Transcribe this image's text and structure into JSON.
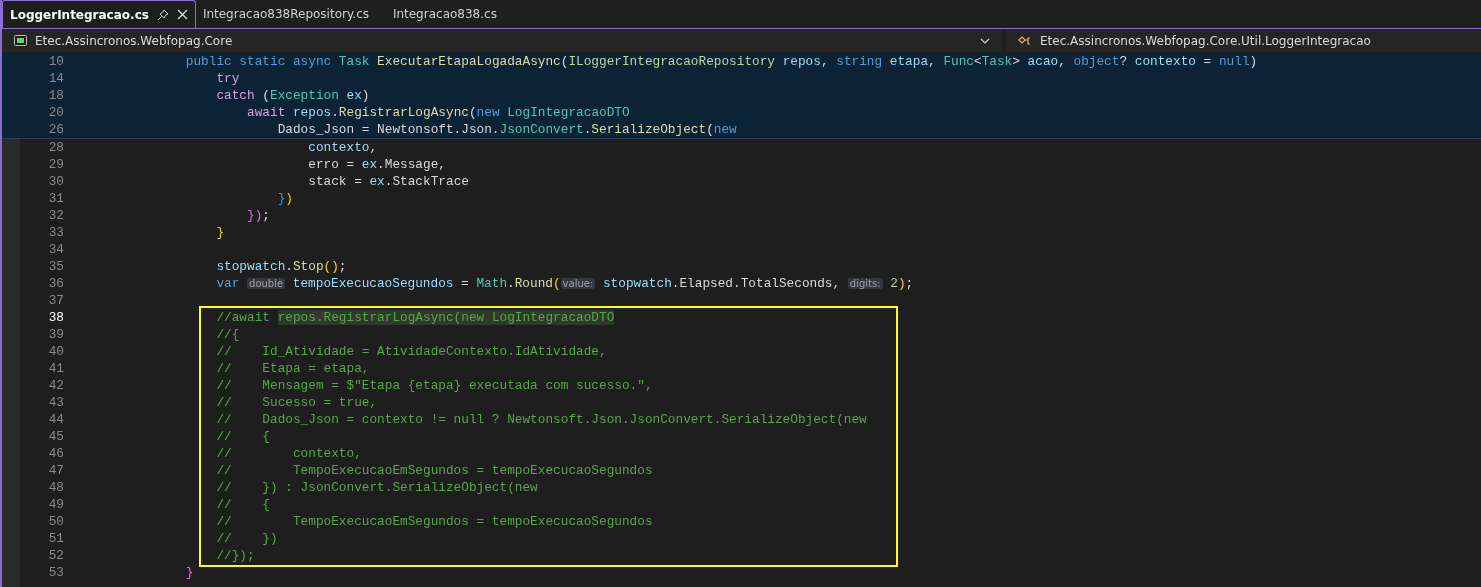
{
  "tabs": [
    {
      "label": "LoggerIntegracao.cs",
      "selected": true
    },
    {
      "label": "Integracao838Repository.cs",
      "selected": false
    },
    {
      "label": "Integracao838.cs",
      "selected": false
    }
  ],
  "navigation": {
    "project": "Etec.Assincronos.Webfopag.Core",
    "member": "Etec.Assincronos.Webfopag.Core.Util.LoggerIntegracao"
  },
  "sticky_lines": [
    {
      "number": "10",
      "tokens": [
        {
          "text": "            public static async ",
          "kind": "kw"
        },
        {
          "text": "Task ",
          "kind": "type"
        },
        {
          "text": "ExecutarEtapaLogadaAsync",
          "kind": "method"
        },
        {
          "text": "(",
          "kind": "plain"
        },
        {
          "text": "ILoggerIntegracaoRepository",
          "kind": "iface"
        },
        {
          "text": " repos",
          "kind": "var"
        },
        {
          "text": ", ",
          "kind": "plain"
        },
        {
          "text": "string",
          "kind": "kw"
        },
        {
          "text": " etapa",
          "kind": "var"
        },
        {
          "text": ", ",
          "kind": "plain"
        },
        {
          "text": "Func",
          "kind": "type"
        },
        {
          "text": "<",
          "kind": "plain"
        },
        {
          "text": "Task",
          "kind": "type"
        },
        {
          "text": "> ",
          "kind": "plain"
        },
        {
          "text": "acao",
          "kind": "var"
        },
        {
          "text": ", ",
          "kind": "plain"
        },
        {
          "text": "object",
          "kind": "kw"
        },
        {
          "text": "? ",
          "kind": "plain"
        },
        {
          "text": "contexto",
          "kind": "var"
        },
        {
          "text": " = ",
          "kind": "plain"
        },
        {
          "text": "null",
          "kind": "kw"
        },
        {
          "text": ")",
          "kind": "plain"
        }
      ]
    },
    {
      "number": "14",
      "tokens": [
        {
          "text": "                try",
          "kind": "ctrl"
        }
      ]
    },
    {
      "number": "18",
      "tokens": [
        {
          "text": "                catch",
          "kind": "ctrl"
        },
        {
          "text": " (",
          "kind": "plain"
        },
        {
          "text": "Exception",
          "kind": "type"
        },
        {
          "text": " ex",
          "kind": "var"
        },
        {
          "text": ")",
          "kind": "plain"
        }
      ]
    },
    {
      "number": "20",
      "tokens": [
        {
          "text": "                    await",
          "kind": "ctrl"
        },
        {
          "text": " repos",
          "kind": "var"
        },
        {
          "text": ".",
          "kind": "plain"
        },
        {
          "text": "RegistrarLogAsync",
          "kind": "method"
        },
        {
          "text": "(",
          "kind": "plain"
        },
        {
          "text": "new",
          "kind": "kw"
        },
        {
          "text": " LogIntegracaoDTO",
          "kind": "type"
        }
      ]
    },
    {
      "number": "26",
      "tokens": [
        {
          "text": "                        Dados_Json = Newtonsoft.Json.",
          "kind": "plain"
        },
        {
          "text": "JsonConvert",
          "kind": "type"
        },
        {
          "text": ".",
          "kind": "plain"
        },
        {
          "text": "SerializeObject",
          "kind": "method"
        },
        {
          "text": "(",
          "kind": "plain"
        },
        {
          "text": "new",
          "kind": "kw"
        }
      ]
    }
  ],
  "lines": [
    {
      "number": "28",
      "current": false,
      "tokens": [
        {
          "text": "                            contexto",
          "kind": "var"
        },
        {
          "text": ",",
          "kind": "plain"
        }
      ]
    },
    {
      "number": "29",
      "current": false,
      "tokens": [
        {
          "text": "                            erro = ",
          "kind": "plain"
        },
        {
          "text": "ex",
          "kind": "var"
        },
        {
          "text": ".Message,",
          "kind": "plain"
        }
      ]
    },
    {
      "number": "30",
      "current": false,
      "tokens": [
        {
          "text": "                            stack = ",
          "kind": "plain"
        },
        {
          "text": "ex",
          "kind": "var"
        },
        {
          "text": ".StackTrace",
          "kind": "plain"
        }
      ]
    },
    {
      "number": "31",
      "current": false,
      "tokens": [
        {
          "text": "                        }",
          "kind": "brace3"
        },
        {
          "text": ")",
          "kind": "brace1"
        }
      ]
    },
    {
      "number": "32",
      "current": false,
      "tokens": [
        {
          "text": "                    })",
          "kind": "brace2"
        },
        {
          "text": ";",
          "kind": "plain"
        }
      ]
    },
    {
      "number": "33",
      "current": false,
      "tokens": [
        {
          "text": "                }",
          "kind": "brace1"
        }
      ]
    },
    {
      "number": "34",
      "current": false
    },
    {
      "number": "35",
      "current": false,
      "tokens": [
        {
          "text": "                stopwatch",
          "kind": "var"
        },
        {
          "text": ".",
          "kind": "plain"
        },
        {
          "text": "Stop",
          "kind": "method"
        },
        {
          "text": "()",
          "kind": "brace1"
        },
        {
          "text": ";",
          "kind": "plain"
        }
      ]
    },
    {
      "number": "36",
      "current": false,
      "tokens": [
        {
          "text": "                var ",
          "kind": "kw"
        },
        {
          "text": "double",
          "kind": "hint"
        },
        {
          "text": " tempoExecucaoSegundos",
          "kind": "var"
        },
        {
          "text": " = ",
          "kind": "plain"
        },
        {
          "text": "Math",
          "kind": "type"
        },
        {
          "text": ".",
          "kind": "plain"
        },
        {
          "text": "Round",
          "kind": "method"
        },
        {
          "text": "(",
          "kind": "brace1"
        },
        {
          "text": "value:",
          "kind": "hint"
        },
        {
          "text": " stopwatch",
          "kind": "var"
        },
        {
          "text": ".Elapsed.TotalSeconds, ",
          "kind": "plain"
        },
        {
          "text": "digits:",
          "kind": "hint"
        },
        {
          "text": " 2",
          "kind": "num"
        },
        {
          "text": ")",
          "kind": "brace1"
        },
        {
          "text": ";",
          "kind": "plain"
        }
      ]
    },
    {
      "number": "37",
      "current": false
    },
    {
      "kind": "highlight_box",
      "lines": [
        {
          "number": "38",
          "current": true,
          "tokens": [
            {
              "text": "                //await ",
              "kind": "comment"
            },
            {
              "text": "repos.RegistrarLogAsync(new LogIntegracaoDTO",
              "kind": "marked"
            }
          ]
        },
        {
          "number": "39",
          "current": false,
          "tokens": [
            {
              "text": "                //{",
              "kind": "comment"
            }
          ]
        },
        {
          "number": "40",
          "current": false,
          "tokens": [
            {
              "text": "                //    Id_Atividade = AtividadeContexto.IdAtividade,",
              "kind": "comment"
            }
          ]
        },
        {
          "number": "41",
          "current": false,
          "tokens": [
            {
              "text": "                //    Etapa = etapa,",
              "kind": "comment"
            }
          ]
        },
        {
          "number": "42",
          "current": false,
          "tokens": [
            {
              "text": "                //    Mensagem = $\"Etapa {etapa} executada com sucesso.\",",
              "kind": "comment"
            }
          ]
        },
        {
          "number": "43",
          "current": false,
          "tokens": [
            {
              "text": "                //    Sucesso = true,",
              "kind": "comment"
            }
          ]
        },
        {
          "number": "44",
          "current": false,
          "tokens": [
            {
              "text": "                //    Dados_Json = contexto != null ? Newtonsoft.Json.JsonConvert.SerializeObject(new",
              "kind": "comment"
            }
          ]
        },
        {
          "number": "45",
          "current": false,
          "tokens": [
            {
              "text": "                //    {",
              "kind": "comment"
            }
          ]
        },
        {
          "number": "46",
          "current": false,
          "tokens": [
            {
              "text": "                //        contexto,",
              "kind": "comment"
            }
          ]
        },
        {
          "number": "47",
          "current": false,
          "tokens": [
            {
              "text": "                //        TempoExecucaoEmSegundos = tempoExecucaoSegundos",
              "kind": "comment"
            }
          ]
        },
        {
          "number": "48",
          "current": false,
          "tokens": [
            {
              "text": "                //    }) : JsonConvert.SerializeObject(new",
              "kind": "comment"
            }
          ]
        },
        {
          "number": "49",
          "current": false,
          "tokens": [
            {
              "text": "                //    {",
              "kind": "comment"
            }
          ]
        },
        {
          "number": "50",
          "current": false,
          "tokens": [
            {
              "text": "                //        TempoExecucaoEmSegundos = tempoExecucaoSegundos",
              "kind": "comment"
            }
          ]
        },
        {
          "number": "51",
          "current": false,
          "tokens": [
            {
              "text": "                //    })",
              "kind": "comment"
            }
          ]
        },
        {
          "number": "52",
          "current": false,
          "tokens": [
            {
              "text": "                //});",
              "kind": "comment"
            }
          ]
        }
      ]
    },
    {
      "number": "53",
      "current": false,
      "tokens": [
        {
          "text": "            }",
          "kind": "brace2"
        }
      ]
    }
  ]
}
